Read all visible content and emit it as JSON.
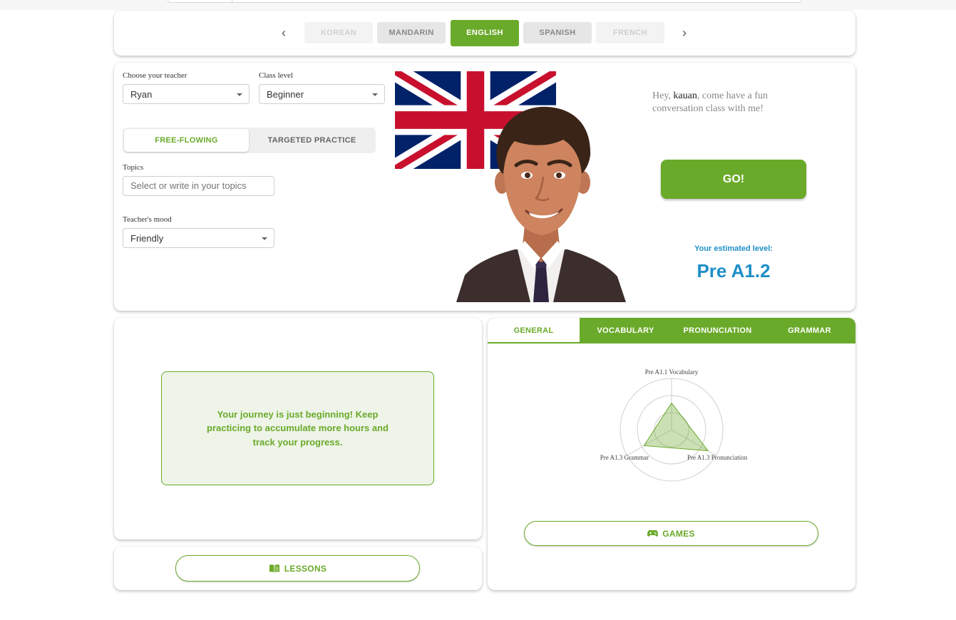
{
  "languages": {
    "prev_icon": "chevron-left-icon",
    "next_icon": "chevron-right-icon",
    "items": [
      {
        "label": "KOREAN",
        "state": "faded"
      },
      {
        "label": "MANDARIN",
        "state": "inactive"
      },
      {
        "label": "ENGLISH",
        "state": "active"
      },
      {
        "label": "SPANISH",
        "state": "inactive"
      },
      {
        "label": "FRENCH",
        "state": "faded"
      }
    ]
  },
  "teacher_form": {
    "teacher_label": "Choose your teacher",
    "teacher_value": "Ryan",
    "level_label": "Class level",
    "level_value": "Beginner",
    "mode_free": "FREE-FLOWING",
    "mode_targeted": "TARGETED PRACTICE",
    "topics_label": "Topics",
    "topics_placeholder": "Select or write in your topics",
    "mood_label": "Teacher's mood",
    "mood_value": "Friendly"
  },
  "greeting": {
    "prefix": "Hey, ",
    "name": "kauan",
    "suffix": ", come have a fun conversation class with me!"
  },
  "go_button": "GO!",
  "estimated": {
    "label": "Your estimated level:",
    "value": "Pre A1.2"
  },
  "journey": {
    "message": "Your journey is just beginning! Keep practicing to accumulate more hours and track your progress."
  },
  "lessons_button": "LESSONS",
  "games_button": "GAMES",
  "skill_tabs": [
    "GENERAL",
    "VOCABULARY",
    "PRONUNCIATION",
    "GRAMMAR"
  ],
  "radar": {
    "axes": [
      "Pre A1.1 Vocabulary",
      "Pre A1.3 Pronunciation",
      "Pre A1.3 Grammar"
    ],
    "values": [
      0.52,
      0.82,
      0.62
    ],
    "rings": 3
  },
  "colors": {
    "accent": "#6aaa2a",
    "level_blue": "#1f8fc8",
    "flag_blue": "#012169",
    "flag_red": "#C8102E"
  }
}
